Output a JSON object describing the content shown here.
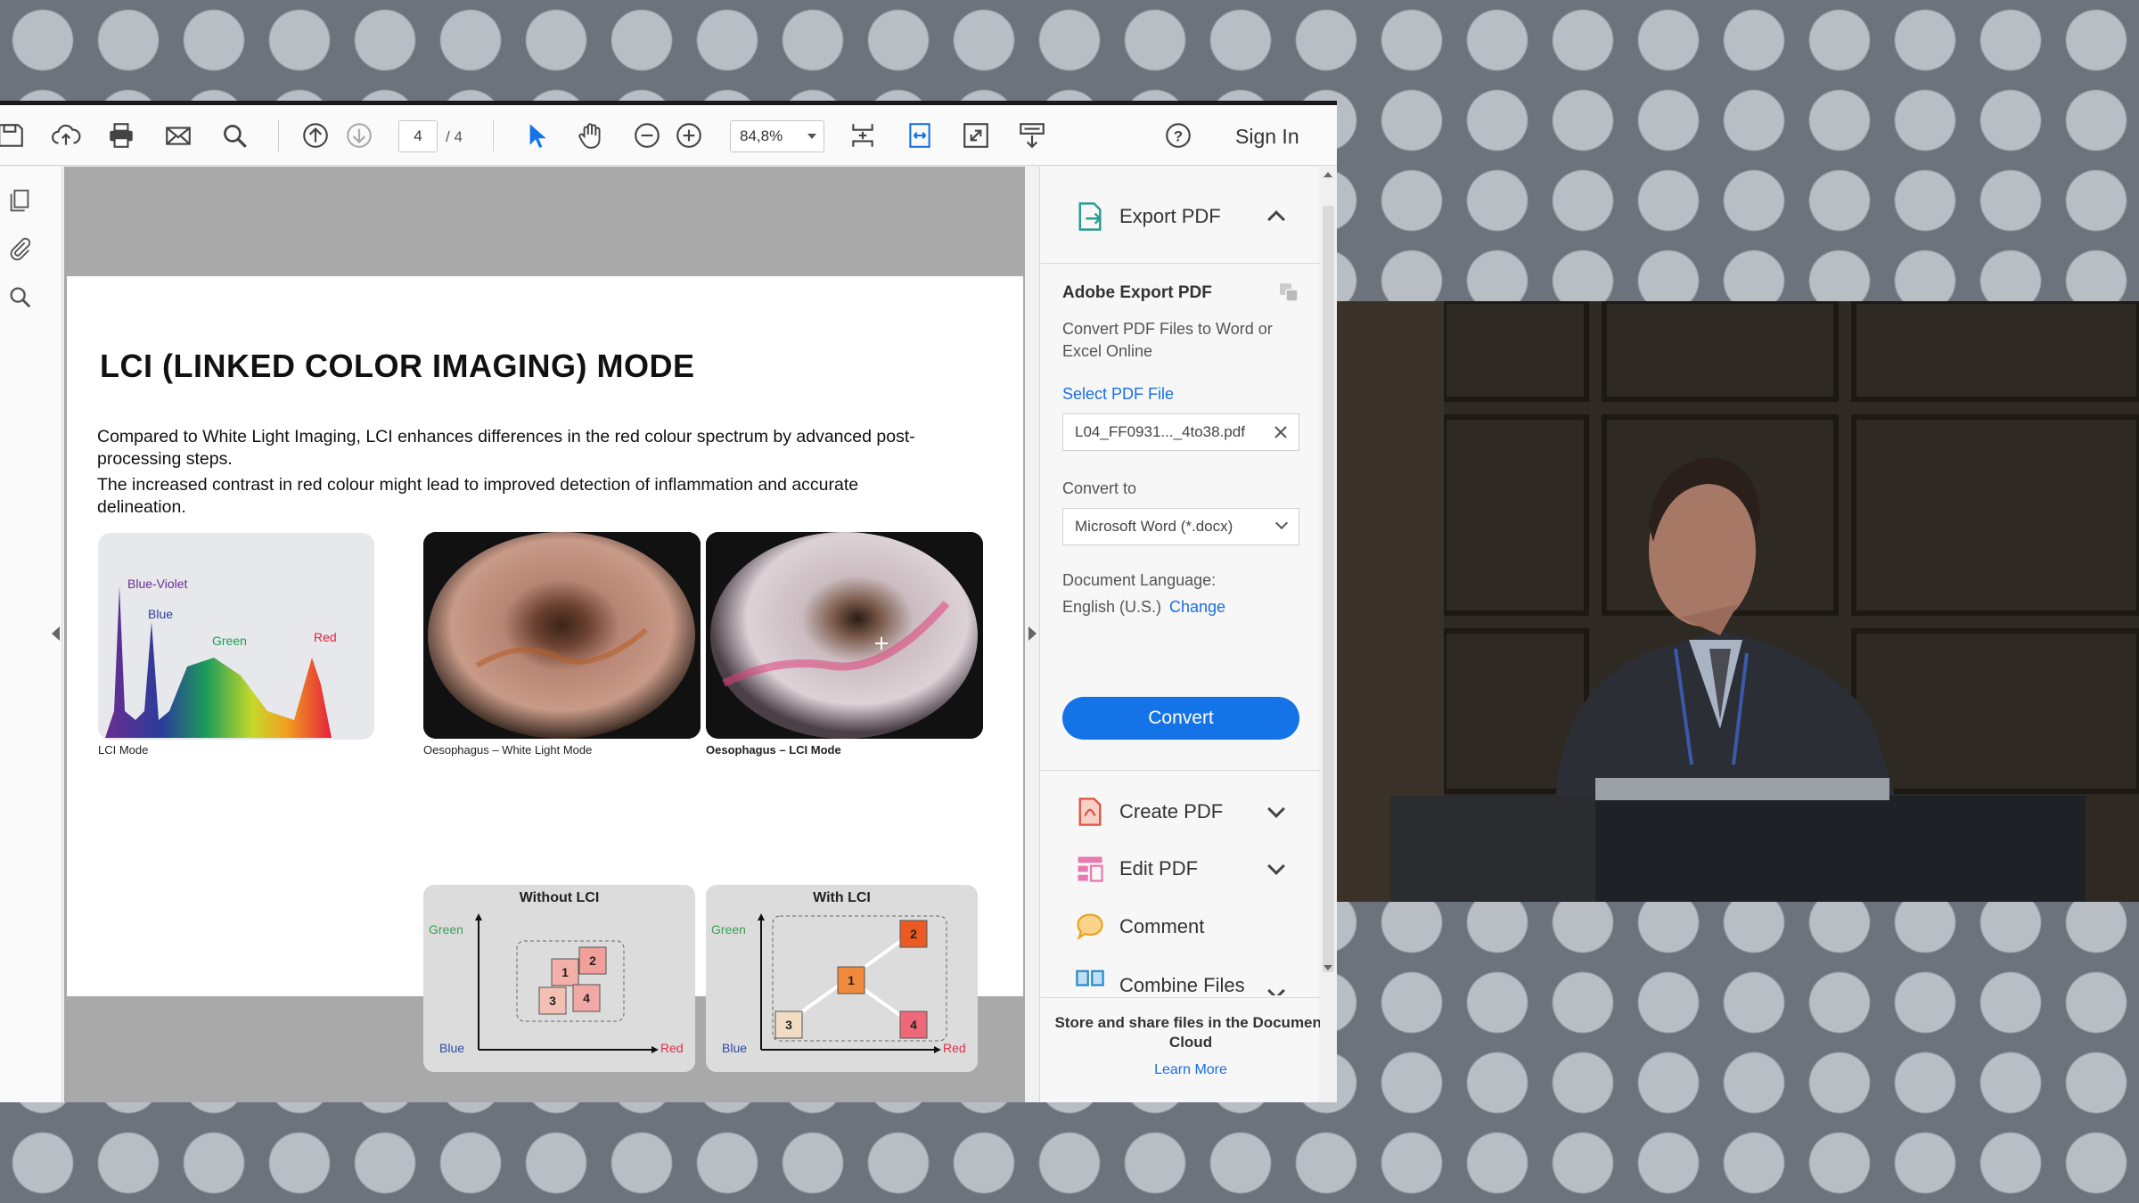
{
  "toolbar": {
    "page_current": "4",
    "page_total": "/ 4",
    "zoom": "84,8%",
    "sign_in": "Sign In",
    "icons": [
      "save-icon",
      "upload-icon",
      "print-icon",
      "mail-icon",
      "search-icon",
      "page-up-icon",
      "page-down-icon",
      "select-arrow-icon",
      "hand-icon",
      "zoom-out-icon",
      "zoom-in-icon",
      "fit-page-icon",
      "fit-width-icon",
      "fullscreen-icon",
      "read-mode-icon",
      "help-icon"
    ]
  },
  "left_rail": {
    "icons": [
      "pages-icon",
      "attachment-icon",
      "search-icon"
    ]
  },
  "slide": {
    "title": "LCI (LINKED COLOR IMAGING) MODE",
    "para1": "Compared to White Light Imaging, LCI enhances differences in the red colour spectrum by advanced post-processing steps.",
    "para2": "The increased contrast in red colour might lead to improved detection of inflammation and accurate delineation.",
    "spectrum_labels": {
      "blue_violet": "Blue-Violet",
      "blue": "Blue",
      "green": "Green",
      "red": "Red"
    },
    "caption_lci_mode": "LCI Mode",
    "caption_wli": "Oesophagus – White Light Mode",
    "caption_lci": "Oesophagus – LCI Mode",
    "diagram_without": {
      "title": "Without LCI",
      "y_label": "Green",
      "x_label_left": "Blue",
      "x_label_right": "Red",
      "boxes": [
        "1",
        "2",
        "3",
        "4"
      ]
    },
    "diagram_with": {
      "title": "With LCI",
      "y_label": "Green",
      "x_label_left": "Blue",
      "x_label_right": "Red",
      "boxes": [
        "1",
        "2",
        "3",
        "4"
      ]
    }
  },
  "right_panel": {
    "export_pdf": "Export PDF",
    "adobe_export_heading": "Adobe Export PDF",
    "description": "Convert PDF Files to Word or Excel Online",
    "select_file_label": "Select PDF File",
    "file_name": "L04_FF0931..._4to38.pdf",
    "convert_to_label": "Convert to",
    "format_value": "Microsoft Word (*.docx)",
    "doc_language_label": "Document Language:",
    "doc_language_value": "English (U.S.)",
    "change_link": "Change",
    "convert_button": "Convert",
    "tools": [
      {
        "label": "Create PDF",
        "icon": "create-pdf-icon"
      },
      {
        "label": "Edit PDF",
        "icon": "edit-pdf-icon"
      },
      {
        "label": "Comment",
        "icon": "comment-icon"
      },
      {
        "label": "Combine Files",
        "icon": "combine-files-icon"
      }
    ],
    "cloud_text": "Store and share files in the Document Cloud",
    "learn_more": "Learn More"
  },
  "colors": {
    "accent_blue": "#1473e6",
    "link_blue": "#1a6ee3",
    "background_gray": "#6c737d",
    "dot_gray": "#b9bec5"
  }
}
